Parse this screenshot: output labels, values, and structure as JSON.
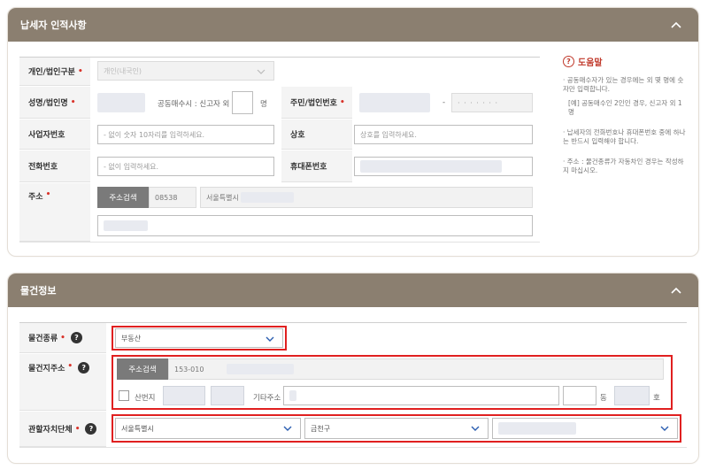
{
  "taxpayer": {
    "title": "납세자 인적사항",
    "type_label": "개인/법인구분",
    "type_value": "개인(내국인)",
    "name_label": "성명/법인명",
    "co_buyer_text": "공동매수시 : 신고자 외",
    "co_buyer_unit": "명",
    "id_label": "주민/법인번호",
    "id_dash": "-",
    "id_masked": "· · · · · · ·",
    "biz_label": "사업자번호",
    "biz_placeholder": "- 없이 숫자 10자리를 입력하세요.",
    "company_label": "상호",
    "company_placeholder": "상호를 입력하세요.",
    "phone_label": "전화번호",
    "phone_placeholder": "- 없이 입력하세요.",
    "mobile_label": "휴대폰번호",
    "address_label": "주소",
    "address_search": "주소검색",
    "zipcode": "08538",
    "address_partial": "서울특별시"
  },
  "help": {
    "title": "도움말",
    "items": [
      "· 공동매수자가 있는 경우에는 외 몇 명에 숫자만 입력합니다.",
      "[예] 공동매수인 2인인 경우, 신고자 외 1명",
      "· 납세자의 전화번호나 휴대폰번호 중에 하나는 반드시 입력해야 합니다.",
      "· 주소 : 물건종류가 자동차인 경우는 작성하지 마십시오."
    ]
  },
  "property": {
    "title": "물건정보",
    "kind_label": "물건종류",
    "kind_value": "부동산",
    "addr_label": "물건지주소",
    "addr_search": "주소검색",
    "zipcode": "153-010",
    "sanbeonji": "산번지",
    "other_addr": "기타주소",
    "dong": "동",
    "ho": "호",
    "jurisdiction_label": "관할자치단체",
    "sido": "서울특별시",
    "sigungu": "금천구"
  },
  "colors": {
    "header": "#8b7f70",
    "required": "#d9342b",
    "highlight": "#e02020"
  }
}
